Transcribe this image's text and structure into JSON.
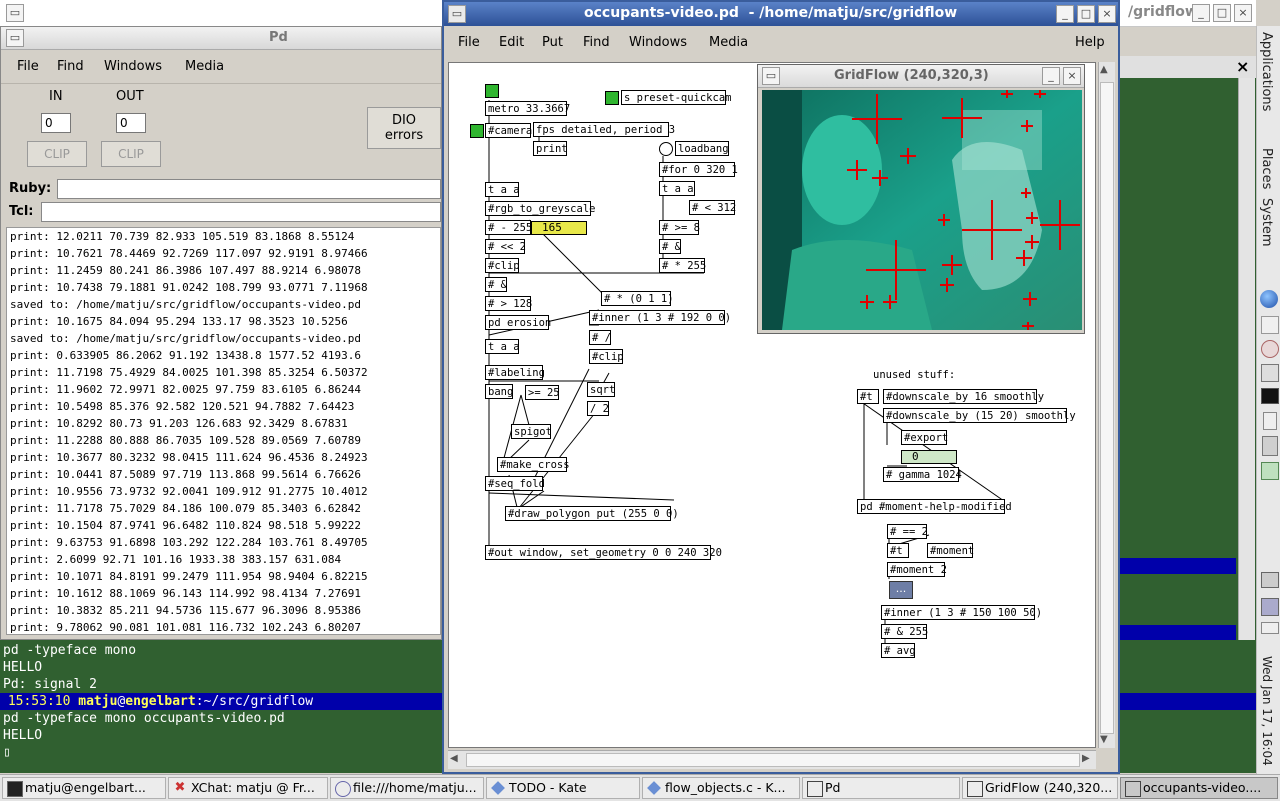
{
  "top_strip": {
    "truncated_title": "/gridflow",
    "buttons": [
      "_",
      "□",
      "×"
    ]
  },
  "right_panel": {
    "applications": "Applications",
    "places": "Places",
    "system": "System",
    "clock": "Wed Jan 17, 16:04"
  },
  "pd_window": {
    "title": "Pd",
    "menu": [
      "File",
      "Find",
      "Windows",
      "Media"
    ],
    "in_label": "IN",
    "out_label": "OUT",
    "in_value": "0",
    "out_value": "0",
    "clip_label": "CLIP",
    "dio_line1": "DIO",
    "dio_line2": "errors",
    "ruby_label": "Ruby:",
    "tcl_label": "Tcl:",
    "print_lines": [
      "print: 12.0211 70.739 82.933 105.519 83.1868 8.55124",
      "print: 10.7621 78.4469 92.7269 117.097 92.9191 8.97466",
      "print: 11.2459 80.241 86.3986 107.497 88.9214 6.98078",
      "print: 10.7438 79.1881 91.0242 108.799 93.0771 7.11968",
      "saved to: /home/matju/src/gridflow/occupants-video.pd",
      "print: 10.1675 84.094 95.294 133.17 98.3523 10.5256",
      "saved to: /home/matju/src/gridflow/occupants-video.pd",
      "print: 0.633905 86.2062 91.192 13438.8 1577.52 4193.6",
      "print: 11.7198 75.4929 84.0025 101.398 85.3254 6.50372",
      "print: 11.9602 72.9971 82.0025 97.759 83.6105 6.86244",
      "print: 10.5498 85.376 92.582 120.521 94.7882 7.64423",
      "print: 10.8292 80.73 91.203 126.683 92.3429 8.67831",
      "print: 11.2288 80.888 86.7035 109.528 89.0569 7.60789",
      "print: 10.3677 80.3232 98.0415 111.624 96.4536 8.24923",
      "print: 10.0441 87.5089 97.719 113.868 99.5614 6.76626",
      "print: 10.9556 73.9732 92.0041 109.912 91.2775 10.4012",
      "print: 11.7178 75.7029 84.186 100.079 85.3403 6.62842",
      "print: 10.1504 87.9741 96.6482 110.824 98.518 5.99222",
      "print: 9.63753 91.6898 103.292 122.284 103.761 8.49705",
      "print: 2.6099 92.71 101.16 1933.38 383.157 631.084",
      "print: 10.1071 84.8191 99.2479 111.954 98.9404 6.82215",
      "print: 10.1612 88.1069 96.143 114.992 98.4134 7.27691",
      "print: 10.3832 85.211 94.5736 115.677 96.3096 8.95386",
      "print: 9.78062 90.081 101.081 116.732 102.243 6.80207"
    ]
  },
  "terminal": {
    "lines": [
      "pd -typeface mono",
      "HELLO",
      "Pd: signal 2"
    ],
    "prompt_time": " 15:53:10",
    "prompt_user": "matju",
    "prompt_at": "@",
    "prompt_host": "engelbart",
    "prompt_path": ":~/src/gridflow",
    "cmd": "pd -typeface mono occupants-video.pd",
    "hello2": "HELLO",
    "cursor": "▯"
  },
  "patch_window": {
    "title": "occupants-video.pd  - /home/matju/src/gridflow",
    "menu": [
      "File",
      "Edit",
      "Put",
      "Find",
      "Windows",
      "Media"
    ],
    "help": "Help",
    "objects": {
      "metro": "metro 33.3667",
      "preset": "s preset-quickcam",
      "camera": "#camera",
      "fps": "fps detailed, period 3",
      "print": "print",
      "loadbang": "loadbang",
      "for": "#for 0 320 1",
      "taa1": "t a a",
      "taa2": "t a a",
      "greyscale": "#rgb_to_greyscale",
      "lt312": "# < 312",
      "minus255": "# - 255",
      "num165": "165",
      "ge8": "# >= 8",
      "shl2": "# << 2",
      "amp1": "# &",
      "clip1": "#clip",
      "times255": "# * 255",
      "amp2": "# &",
      "gt128": "# > 128",
      "times011": "# * (0 1 1)",
      "erosion": "pd erosion",
      "inner1": "#inner (1 3 # 192 0 0)",
      "taa3": "t a a",
      "div": "# /",
      "clip2": "#clip",
      "labeling": "#labeling",
      "sqrt": "sqrt",
      "bang": "bang",
      "ge25": ">= 25",
      "div2": "/ 2",
      "spigot": "spigot",
      "make_cross": "#make_cross",
      "seq_fold": "#seq_fold",
      "draw_polygon": "#draw_polygon put (255 0 0)",
      "out_window": "#out window, set_geometry 0 0 240 320",
      "unused": "unused stuff:",
      "t1": "#t",
      "downscale1": "#downscale_by 16 smoothly",
      "downscale2": "#downscale_by (15 20) smoothly",
      "export": "#export",
      "num0": "0",
      "gamma": "# gamma 1024",
      "moment_help": "pd #moment-help-modified",
      "eq2": "# == 2",
      "t2": "#t",
      "moment": "#moment",
      "moment2": "#moment 2",
      "dots": "...",
      "inner2": "#inner (1 3 # 150 100 50)",
      "amp255": "# & 255",
      "avg": "# avg"
    }
  },
  "gridflow_window": {
    "title": "GridFlow (240,320,3)",
    "close": "×"
  },
  "taskbar": {
    "tasks": [
      "matju@engelbart...",
      "XChat: matju @ Fr...",
      "file:///home/matju...",
      "TODO - Kate",
      "flow_objects.c - K...",
      "Pd",
      "GridFlow (240,320...",
      "occupants-video...."
    ]
  },
  "colors": {
    "terminal_bg": "#306030",
    "prompt_bar": "#0000aa",
    "titlebar_active": "#2d5196",
    "toggle_green": "#2fb52f",
    "numbox_yellow": "#e8e84a",
    "cross_red": "#e00000",
    "video_teal": "#1aa08a"
  }
}
